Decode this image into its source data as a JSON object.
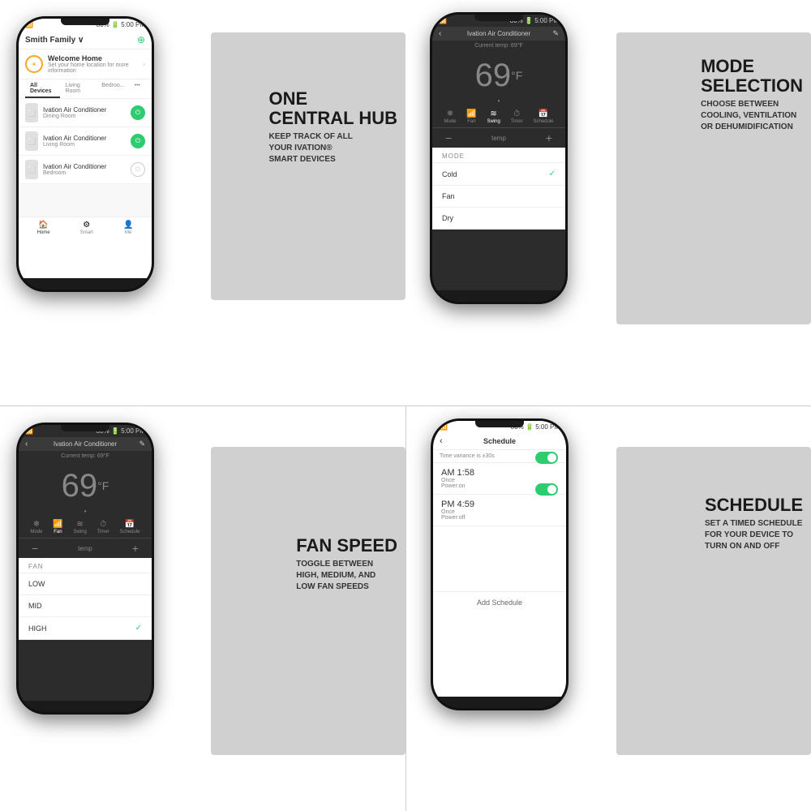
{
  "cells": {
    "tl": {
      "gray_text_title": "ONE\nCENTRAL HUB",
      "gray_text_sub": "KEEP TRACK OF ALL\nYOUR IVATION®\nSMART DEVICES",
      "phone": {
        "status": "80% ▌ 5:00 PM",
        "app_title": "Smith Family ∨",
        "welcome_title": "Welcome Home",
        "welcome_sub": "Set your home location for more information",
        "tabs": [
          "All Devices",
          "Living Room",
          "Bedroo...",
          "•••"
        ],
        "devices": [
          {
            "name": "Ivation Air Conditioner",
            "location": "Dining Room",
            "on": true
          },
          {
            "name": "Ivation Air Conditioner",
            "location": "Living Room",
            "on": true
          },
          {
            "name": "Ivation Air Conditioner",
            "location": "Bedroom",
            "on": false
          }
        ],
        "nav": [
          "Home",
          "Smart",
          "Me"
        ]
      }
    },
    "tr": {
      "gray_text_title": "MODE\nSELECTION",
      "gray_text_sub": "CHOOSE BETWEEN\nCOOLING, VENTILATION\nOR DEHUMIDIFICATION",
      "phone": {
        "status": "80% ▌ 5:00 PM",
        "header": "Ivation Air Conditioner",
        "ac_status": "Current temp: 69°F",
        "temp": "69",
        "temp_unit": "F",
        "controls": [
          "Mode",
          "Fan",
          "Swing",
          "Timer",
          "Schedule"
        ],
        "mode_list": [
          "MODE",
          "Cold",
          "Fan",
          "Dry"
        ],
        "mode_selected": "Cold"
      }
    },
    "bl": {
      "gray_text_title": "FAN SPEED",
      "gray_text_sub": "TOGGLE BETWEEN\nHIGH, MEDIUM, AND\nLOW FAN SPEEDS",
      "phone": {
        "status": "80% ▌ 5:00 PM",
        "header": "Ivation Air Conditioner",
        "ac_status": "Current temp: 69°F",
        "temp": "69",
        "temp_unit": "F",
        "controls": [
          "Mode",
          "Fan",
          "Swing",
          "Timer",
          "Schedule"
        ],
        "fan_list": [
          "FAN",
          "LOW",
          "MID",
          "HIGH"
        ],
        "fan_selected": "HIGH"
      }
    },
    "br": {
      "gray_text_title": "SCHEDULE",
      "gray_text_sub": "SET A TIMED SCHEDULE\nFOR YOUR DEVICE TO\nTURN ON AND OFF",
      "phone": {
        "status": "80% ▌ 5:00 PM",
        "header": "Schedule",
        "notice": "Time variance is ±30s",
        "schedules": [
          {
            "time": "AM 1:58",
            "freq": "Once",
            "action": "Power:on",
            "enabled": true
          },
          {
            "time": "PM 4:59",
            "freq": "Once",
            "action": "Power:off",
            "enabled": true
          }
        ],
        "add_label": "Add Schedule"
      }
    }
  }
}
